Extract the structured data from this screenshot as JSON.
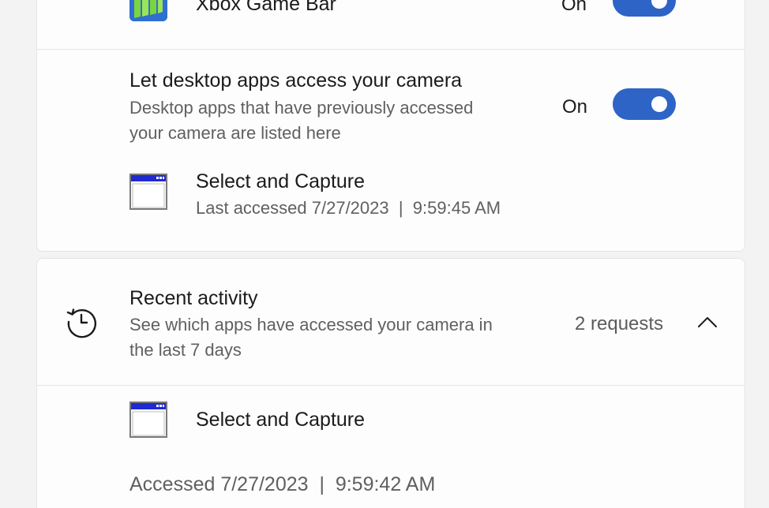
{
  "xbox_row": {
    "title": "Xbox Game Bar",
    "state": "On"
  },
  "desktop_apps": {
    "title": "Let desktop apps access your camera",
    "description_line1": "Desktop apps that have previously accessed",
    "description_line2": "your camera are listed here",
    "state": "On",
    "app": {
      "name": "Select and Capture",
      "last_accessed": "Last accessed 7/27/2023  |  9:59:45 AM"
    }
  },
  "recent_activity": {
    "title": "Recent activity",
    "description_line1": "See which apps have accessed your camera in",
    "description_line2": "the last 7 days",
    "count": "2 requests",
    "items": [
      {
        "name": "Select and Capture",
        "accessed": "Accessed 7/27/2023  |  9:59:42 AM"
      }
    ]
  },
  "colors": {
    "accent": "#2d64c6",
    "card_background": "#fdfdfd",
    "page_background": "#f3f3f3"
  }
}
